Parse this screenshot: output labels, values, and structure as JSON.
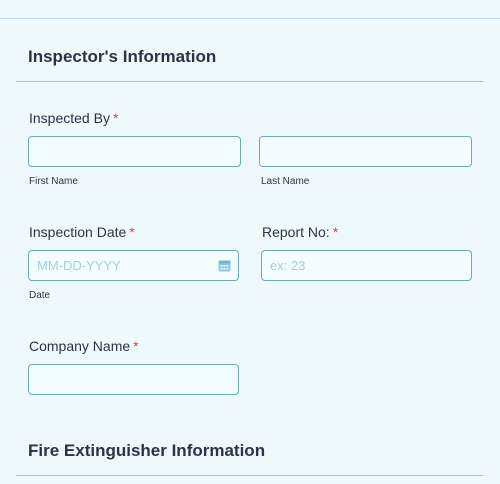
{
  "sections": {
    "inspector": {
      "title": "Inspector's Information"
    },
    "extinguisher": {
      "title": "Fire Extinguisher Information"
    }
  },
  "fields": {
    "inspected_by": {
      "label": "Inspected By",
      "required_mark": "*",
      "first_name": {
        "value": "",
        "sublabel": "First Name"
      },
      "last_name": {
        "value": "",
        "sublabel": "Last Name"
      }
    },
    "inspection_date": {
      "label": "Inspection Date",
      "required_mark": "*",
      "value": "",
      "placeholder": "MM-DD-YYYY",
      "sublabel": "Date",
      "icon": "calendar-icon"
    },
    "report_no": {
      "label": "Report No:",
      "required_mark": "*",
      "value": "",
      "placeholder": "ex: 23"
    },
    "company_name": {
      "label": "Company Name",
      "required_mark": "*",
      "value": ""
    }
  },
  "colors": {
    "background": "#eef9fc",
    "text": "#2c3345",
    "required": "#f23a3c",
    "input_border": "#6fa9b8",
    "placeholder": "#a3cfdb",
    "divider": "#8fcfdd"
  }
}
